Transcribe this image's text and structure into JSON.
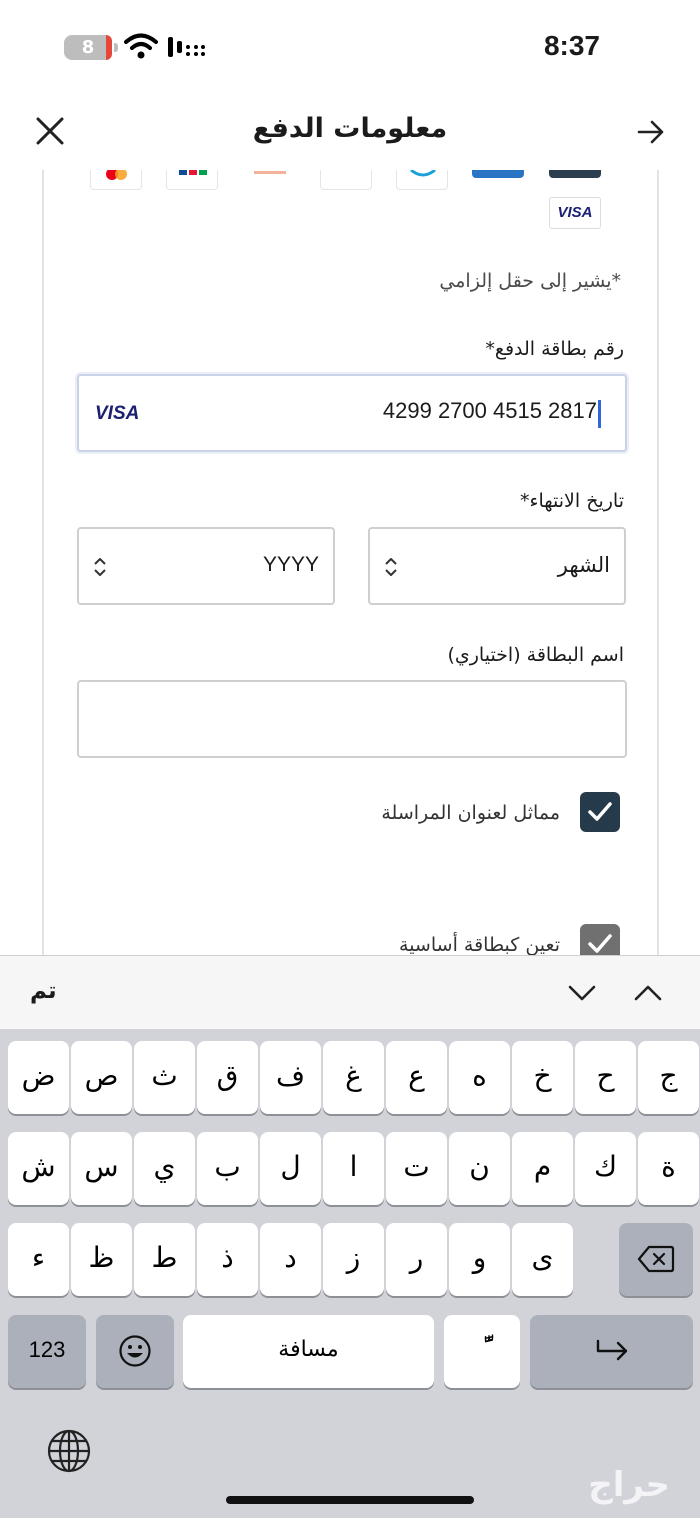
{
  "status_bar": {
    "battery": "8",
    "time": "8:37"
  },
  "header": {
    "title": "معلومات الدفع"
  },
  "card_brands": {
    "visa": "VISA"
  },
  "form": {
    "required_note": "*يشير إلى حقل إلزامي",
    "card_number_label": "رقم بطاقة الدفع*",
    "card_number_value": "4299 2700 4515 2817",
    "card_brand": "VISA",
    "expiry_label": "تاريخ الانتهاء*",
    "month_value": "الشهر",
    "year_value": "YYYY",
    "card_name_label": "اسم البطاقة (اختياري)",
    "card_name_value": "",
    "same_address_label": "مماثل لعنوان المراسلة",
    "same_address_checked": true,
    "primary_card_label": "تعين كبطاقة أساسية",
    "primary_card_checked": true,
    "checkbox_color": "#253a4b"
  },
  "keyboard": {
    "done_label": "تم",
    "row1": [
      "ض",
      "ص",
      "ث",
      "ق",
      "ف",
      "غ",
      "ع",
      "ه",
      "خ",
      "ح",
      "ج"
    ],
    "row2": [
      "ش",
      "س",
      "ي",
      "ب",
      "ل",
      "ا",
      "ت",
      "ن",
      "م",
      "ك",
      "ة"
    ],
    "row3": [
      "ء",
      "ظ",
      "ط",
      "ذ",
      "د",
      "ز",
      "ر",
      "و",
      "ى"
    ],
    "numbers_label": "123",
    "space_label": "مسافة",
    "diacritic_label": "ًّ",
    "watermark": "حراج"
  }
}
